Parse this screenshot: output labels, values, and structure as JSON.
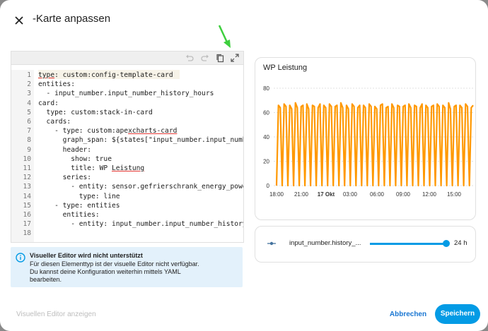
{
  "dialog": {
    "title": "-Karte anpassen"
  },
  "editor": {
    "lines": [
      {
        "num": "1",
        "text": "type: custom:config-template-card"
      },
      {
        "num": "2",
        "text": "entities:"
      },
      {
        "num": "3",
        "text": "  - input_number.input_number_history_hours"
      },
      {
        "num": "4",
        "text": "card:"
      },
      {
        "num": "5",
        "text": "  type: custom:stack-in-card"
      },
      {
        "num": "6",
        "text": "  cards:"
      },
      {
        "num": "7",
        "text": "    - type: custom:apexcharts-card"
      },
      {
        "num": "8",
        "text": "      graph_span: ${states[\"input_number.input_number"
      },
      {
        "num": "9",
        "text": "      header:"
      },
      {
        "num": "10",
        "text": "        show: true"
      },
      {
        "num": "11",
        "text": "        title: WP Leistung"
      },
      {
        "num": "12",
        "text": "      series:"
      },
      {
        "num": "13",
        "text": "        - entity: sensor.gefrierschrank_energy_powe"
      },
      {
        "num": "14",
        "text": "          type: line"
      },
      {
        "num": "15",
        "text": "    - type: entities"
      },
      {
        "num": "16",
        "text": "      entities:"
      },
      {
        "num": "17",
        "text": "        - entity: input_number.input_number_history_"
      },
      {
        "num": "18",
        "text": ""
      }
    ]
  },
  "info": {
    "title": "Visueller Editor wird nicht unterstützt",
    "lines": [
      "Für diesen Elementtyp ist der visuelle Editor nicht verfügbar.",
      "Du kannst deine Konfiguration weiterhin mittels YAML",
      "bearbeiten."
    ]
  },
  "preview": {
    "title": "WP Leistung",
    "slider_label": "input_number.history_...",
    "slider_value": "24 h",
    "slider_fraction": 1.0
  },
  "chart_data": {
    "type": "line",
    "title": "WP Leistung",
    "y_ticks": [
      "0",
      "20",
      "40",
      "60",
      "80"
    ],
    "ylim": [
      0,
      80
    ],
    "x_ticks": [
      "18:00",
      "21:00",
      "17 Okt",
      "03:00",
      "06:00",
      "09:00",
      "12:00",
      "15:00"
    ],
    "series": [
      {
        "values": [
          0,
          66,
          64,
          0,
          67,
          65,
          0,
          66,
          63,
          0,
          68,
          64,
          0,
          65,
          66,
          0,
          67,
          63,
          0,
          66,
          65,
          0,
          64,
          67,
          0,
          66,
          64,
          0,
          67,
          65,
          0,
          65,
          66,
          0,
          68,
          64,
          0,
          66,
          63,
          0,
          67,
          65,
          0,
          64,
          66,
          0,
          66,
          64,
          0,
          67,
          65,
          0,
          65,
          63,
          0,
          66,
          67,
          0,
          64,
          65,
          0,
          67,
          64,
          0,
          66,
          65,
          0,
          65,
          66,
          0,
          67,
          64,
          0,
          66,
          65,
          0,
          64,
          67,
          0,
          66,
          64,
          0,
          65,
          66,
          0,
          67,
          65,
          0,
          66,
          64,
          0,
          68,
          63,
          0,
          65,
          66,
          0,
          66,
          64,
          0,
          67,
          65,
          0,
          64,
          66
        ]
      }
    ],
    "color": "#ff9800"
  },
  "footer": {
    "visual_editor": "Visuellen Editor anzeigen",
    "cancel": "Abbrechen",
    "save": "Speichern"
  }
}
